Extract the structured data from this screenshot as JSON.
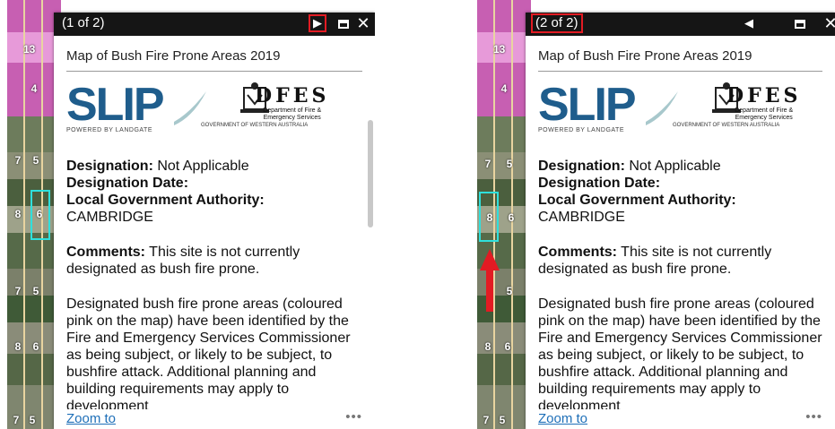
{
  "colors": {
    "title_bar": "#151515",
    "highlight": "#e21b23",
    "link": "#1e6fb8",
    "selection": "#2fe0dc",
    "bushfire_pink": "#c75fb2"
  },
  "map_lots": [
    "13",
    "4",
    "7",
    "5",
    "8",
    "6",
    "7",
    "5",
    "8",
    "6",
    "7",
    "5"
  ],
  "popups": [
    {
      "counter": "(1 of 2)",
      "nav_glyph": "▶",
      "nav_icon": "next-arrow-icon",
      "layer_title": "Map of Bush Fire Prone Areas 2019",
      "logos": {
        "slip": "SLIP",
        "slip_sub": "POWERED BY LANDGATE",
        "govt_sub": "GOVERNMENT OF WESTERN AUSTRALIA",
        "dfes": "DFES",
        "dfes_sub1": "Department of Fire &",
        "dfes_sub2": "Emergency Services"
      },
      "designation_label": "Designation:",
      "designation_value": "Not Applicable",
      "designation_date_label": "Designation Date:",
      "lga_label": "Local Government Authority:",
      "lga_value": "CAMBRIDGE",
      "comments_label": "Comments:",
      "comments_value": "This site is not currently designated as bush fire prone.",
      "paragraph": "Designated bush fire prone areas (coloured pink on the map) have been identified by the Fire and Emergency Services Commissioner as being subject, or likely to be subject, to bushfire attack. Additional planning and building requirements may apply to development",
      "zoom_label": "Zoom to",
      "more_label": "•••"
    },
    {
      "counter": "(2 of 2)",
      "nav_glyph": "◀",
      "nav_icon": "previous-arrow-icon",
      "layer_title": "Map of Bush Fire Prone Areas 2019",
      "logos": {
        "slip": "SLIP",
        "slip_sub": "POWERED BY LANDGATE",
        "govt_sub": "GOVERNMENT OF WESTERN AUSTRALIA",
        "dfes": "DFES",
        "dfes_sub1": "Department of Fire &",
        "dfes_sub2": "Emergency Services"
      },
      "designation_label": "Designation:",
      "designation_value": "Not Applicable",
      "designation_date_label": "Designation Date:",
      "lga_label": "Local Government Authority:",
      "lga_value": "CAMBRIDGE",
      "comments_label": "Comments:",
      "comments_value": "This site is not currently designated as bush fire prone.",
      "paragraph": "Designated bush fire prone areas (coloured pink on the map) have been identified by the Fire and Emergency Services Commissioner as being subject, or likely to be subject, to bushfire attack. Additional planning and building requirements may apply to development",
      "zoom_label": "Zoom to",
      "more_label": "•••"
    }
  ]
}
